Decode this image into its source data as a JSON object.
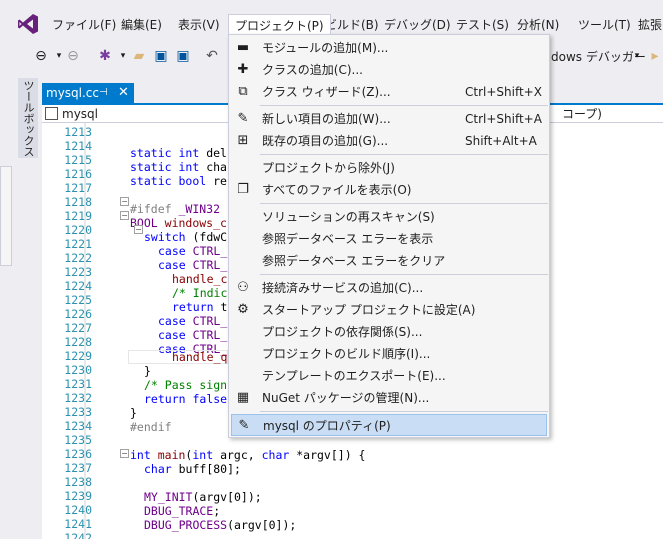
{
  "menubar": {
    "items": [
      "ファイル(F)",
      "編集(E)",
      "表示(V)",
      "プロジェクト(P)",
      "ビルド(B)",
      "デバッグ(D)",
      "テスト(S)",
      "分析(N)",
      "ツール(T)",
      "拡張"
    ]
  },
  "toolbar": {
    "debugger_label": "dows デバッガー"
  },
  "toolbox": {
    "label": "ツールボックス"
  },
  "document_tab": {
    "title": "mysql.cc",
    "pin": "⊣",
    "close": "✕"
  },
  "navbar": {
    "project": "mysql",
    "scope": "コープ)"
  },
  "editor": {
    "line_numbers": [
      "1213",
      "1214",
      "1215",
      "1216",
      "1217",
      "1218",
      "1219",
      "1220",
      "1221",
      "1222",
      "1223",
      "1224",
      "1225",
      "1226",
      "1227",
      "1228",
      "1229",
      "1230",
      "1231",
      "1232",
      "1233",
      "1234",
      "1235",
      "1236",
      "1237",
      "1238",
      "1239",
      "1240",
      "1241",
      "1242"
    ]
  },
  "menu": {
    "items": [
      {
        "label": "モジュールの追加(M)...",
        "shortcut": "",
        "icon": "module-icon"
      },
      {
        "label": "クラスの追加(C)...",
        "shortcut": "",
        "icon": "add-class-icon"
      },
      {
        "label": "クラス ウィザード(Z)...",
        "shortcut": "Ctrl+Shift+X",
        "icon": "class-wizard-icon"
      },
      {
        "label": "新しい項目の追加(W)...",
        "shortcut": "Ctrl+Shift+A",
        "icon": "new-item-icon"
      },
      {
        "label": "既存の項目の追加(G)...",
        "shortcut": "Shift+Alt+A",
        "icon": "existing-item-icon"
      },
      {
        "label": "プロジェクトから除外(J)",
        "shortcut": "",
        "icon": ""
      },
      {
        "label": "すべてのファイルを表示(O)",
        "shortcut": "",
        "icon": "show-all-files-icon"
      },
      {
        "label": "ソリューションの再スキャン(S)",
        "shortcut": "",
        "icon": ""
      },
      {
        "label": "参照データベース エラーを表示",
        "shortcut": "",
        "icon": ""
      },
      {
        "label": "参照データベース エラーをクリア",
        "shortcut": "",
        "icon": ""
      },
      {
        "label": "接続済みサービスの追加(C)...",
        "shortcut": "",
        "icon": "connected-service-icon"
      },
      {
        "label": "スタートアップ プロジェクトに設定(A)",
        "shortcut": "",
        "icon": "gear-icon"
      },
      {
        "label": "プロジェクトの依存関係(S)...",
        "shortcut": "",
        "icon": ""
      },
      {
        "label": "プロジェクトのビルド順序(I)...",
        "shortcut": "",
        "icon": ""
      },
      {
        "label": "テンプレートのエクスポート(E)...",
        "shortcut": "",
        "icon": ""
      },
      {
        "label": "NuGet パッケージの管理(N)...",
        "shortcut": "",
        "icon": "nuget-icon"
      },
      {
        "label": "mysql のプロパティ(P)",
        "shortcut": "",
        "icon": "wrench-icon"
      }
    ]
  }
}
